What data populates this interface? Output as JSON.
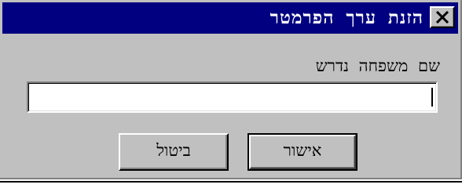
{
  "window": {
    "title": "הזנת ערך הפרמטר",
    "close_icon": "close-icon"
  },
  "prompt": {
    "label": "שם משפחה נדרש"
  },
  "input": {
    "value": ""
  },
  "buttons": {
    "ok_label": "אישור",
    "cancel_label": "ביטול"
  },
  "colors": {
    "titlebar": "#000080",
    "face": "#c0c0c0"
  }
}
